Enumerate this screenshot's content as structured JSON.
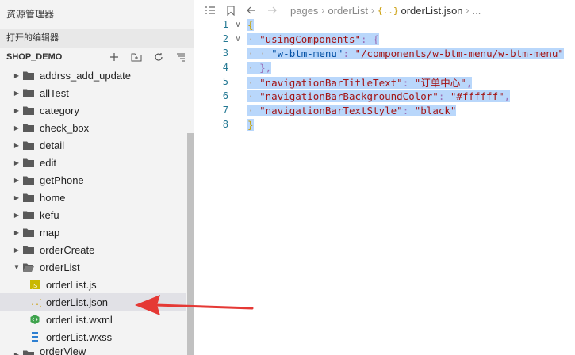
{
  "sidebar": {
    "title": "资源管理器",
    "open_editors": "打开的编辑器",
    "project_name": "SHOP_DEMO",
    "actions": [
      "new-file-icon",
      "new-folder-icon",
      "refresh-icon",
      "collapse-icon"
    ],
    "tree": [
      {
        "label": "addrss_add_update",
        "type": "folder",
        "expanded": false
      },
      {
        "label": "allTest",
        "type": "folder",
        "expanded": false
      },
      {
        "label": "category",
        "type": "folder",
        "expanded": false
      },
      {
        "label": "check_box",
        "type": "folder",
        "expanded": false
      },
      {
        "label": "detail",
        "type": "folder",
        "expanded": false
      },
      {
        "label": "edit",
        "type": "folder",
        "expanded": false
      },
      {
        "label": "getPhone",
        "type": "folder",
        "expanded": false
      },
      {
        "label": "home",
        "type": "folder",
        "expanded": false
      },
      {
        "label": "kefu",
        "type": "folder",
        "expanded": false
      },
      {
        "label": "map",
        "type": "folder",
        "expanded": false
      },
      {
        "label": "orderCreate",
        "type": "folder",
        "expanded": false
      },
      {
        "label": "orderList",
        "type": "folder",
        "expanded": true
      },
      {
        "label": "orderList.js",
        "type": "file",
        "icon": "js-file-icon"
      },
      {
        "label": "orderList.json",
        "type": "file",
        "icon": "json-file-icon",
        "selected": true
      },
      {
        "label": "orderList.wxml",
        "type": "file",
        "icon": "wxml-file-icon"
      },
      {
        "label": "orderList.wxss",
        "type": "file",
        "icon": "wxss-file-icon"
      },
      {
        "label": "orderView",
        "type": "folder",
        "expanded": false
      }
    ]
  },
  "editor": {
    "breadcrumb": {
      "pages": "pages",
      "folder": "orderList",
      "file": "orderList.json",
      "file_icon_text": "{..}",
      "ellipsis": "..."
    },
    "lines": [
      {
        "num": "1",
        "fold": "∨"
      },
      {
        "num": "2",
        "fold": "∨"
      },
      {
        "num": "3",
        "fold": ""
      },
      {
        "num": "4",
        "fold": ""
      },
      {
        "num": "5",
        "fold": ""
      },
      {
        "num": "6",
        "fold": ""
      },
      {
        "num": "7",
        "fold": ""
      },
      {
        "num": "8",
        "fold": ""
      }
    ],
    "code": {
      "open_brace": "{",
      "close_brace": "}",
      "usingComponents_key": "\"usingComponents\"",
      "btm_menu_key": "\"w-btm-menu\"",
      "btm_menu_value": "\"/components/w-btm-menu/w-btm-menu\"",
      "inner_close": "},",
      "nav_title_key": "\"navigationBarTitleText\"",
      "nav_title_value": "\"订单中心\"",
      "nav_bg_key": "\"navigationBarBackgroundColor\"",
      "nav_bg_value": "\"#ffffff\"",
      "nav_text_key": "\"navigationBarTextStyle\"",
      "nav_text_value": "\"black\""
    }
  },
  "colors": {
    "selection": "#b9d7fb",
    "arrow": "#e53935",
    "json_icon": "#c99a00",
    "js_icon": "#c9b800",
    "wxml_icon": "#3fa34d",
    "wxss_icon": "#2d7fd1"
  }
}
